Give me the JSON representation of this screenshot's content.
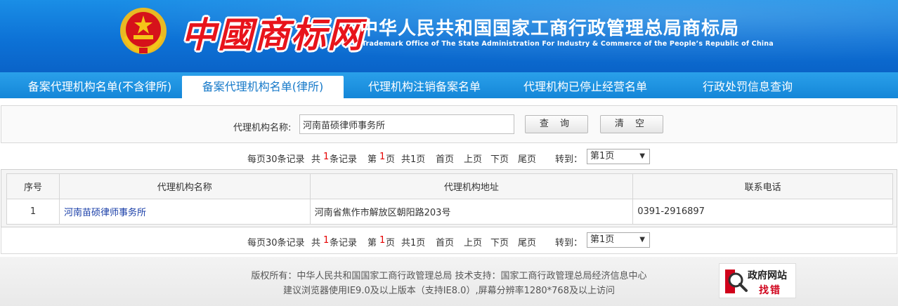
{
  "header": {
    "logo_text": "中國商标网",
    "org_title": "中华人民共和国国家工商行政管理总局商标局",
    "org_subtitle": "Trademark Office of The State Administration For Industry & Commerce of the People’s Republic of China"
  },
  "nav": {
    "tabs": [
      {
        "label": "备案代理机构名单(不含律所)",
        "active": false
      },
      {
        "label": "备案代理机构名单(律所)",
        "active": true
      },
      {
        "label": "代理机构注销备案名单",
        "active": false
      },
      {
        "label": "代理机构已停止经营名单",
        "active": false
      },
      {
        "label": "行政处罚信息查询",
        "active": false
      }
    ]
  },
  "search": {
    "label": "代理机构名称:",
    "value": "河南苗硕律师事务所",
    "query_button": "查 询",
    "clear_button": "清 空"
  },
  "pager": {
    "per_page": "每页30条记录",
    "total_prefix": "共",
    "total_count": "1",
    "total_suffix": "条记录",
    "page_prefix": "第",
    "page_current": "1",
    "page_suffix": "页",
    "page_total": "共1页",
    "first": "首页",
    "prev": "上页",
    "next": "下页",
    "last": "尾页",
    "goto_label": "转到：",
    "goto_selected": "第1页"
  },
  "table": {
    "headers": [
      "序号",
      "代理机构名称",
      "代理机构地址",
      "联系电话"
    ],
    "rows": [
      {
        "index": "1",
        "name": "河南苗硕律师事务所",
        "address": "河南省焦作市解放区朝阳路203号",
        "phone": "0391-2916897"
      }
    ]
  },
  "footer": {
    "line1": "版权所有：中华人民共和国国家工商行政管理总局 技术支持：国家工商行政管理总局经济信息中心",
    "line2": "建议浏览器使用IE9.0及以上版本（支持IE8.0）,屏幕分辨率1280*768及以上访问",
    "badge_title": "政府网站",
    "badge_action": "找错"
  },
  "colors": {
    "header_blue": "#0d72d6",
    "nav_blue": "#1486d8",
    "logo_red": "#e8141b",
    "count_red": "#e60000",
    "link_blue": "#1a3fa8"
  }
}
